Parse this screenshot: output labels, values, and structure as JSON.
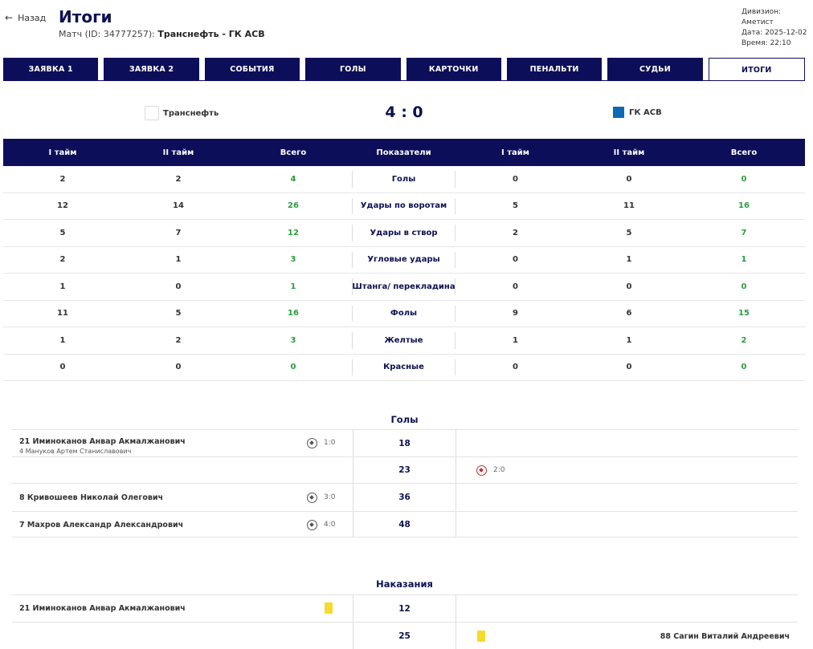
{
  "header": {
    "back_label": "Назад",
    "back_arrow": "←",
    "title": "Итоги",
    "match_prefix": "Матч (ID: 34777257):",
    "match_teams": "Транснефть - ГК АСВ",
    "division": "Дивизион: Аметист",
    "date": "Дата: 2025-12-02",
    "time": "Время: 22:10"
  },
  "tabs": [
    "ЗАЯВКА 1",
    "ЗАЯВКА 2",
    "СОБЫТИЯ",
    "ГОЛЫ",
    "КАРТОЧКИ",
    "ПЕНАЛЬТИ",
    "СУДЬИ",
    "ИТОГИ"
  ],
  "active_tab": 7,
  "teams": {
    "home": {
      "name": "Транснефть",
      "color": "#ffffff"
    },
    "away": {
      "name": "ГК АСВ",
      "color": "#0b6ab7"
    },
    "score": "4 : 0"
  },
  "stats": {
    "headers": [
      "I тайм",
      "II тайм",
      "Всего",
      "Показатели",
      "I тайм",
      "II тайм",
      "Всего"
    ],
    "rows": [
      [
        "2",
        "2",
        "4",
        "Голы",
        "0",
        "0",
        "0"
      ],
      [
        "12",
        "14",
        "26",
        "Удары по воротам",
        "5",
        "11",
        "16"
      ],
      [
        "5",
        "7",
        "12",
        "Удары в створ",
        "2",
        "5",
        "7"
      ],
      [
        "2",
        "1",
        "3",
        "Угловые удары",
        "0",
        "1",
        "1"
      ],
      [
        "1",
        "0",
        "1",
        "Штанга/ перекладина",
        "0",
        "0",
        "0"
      ],
      [
        "11",
        "5",
        "16",
        "Фолы",
        "9",
        "6",
        "15"
      ],
      [
        "1",
        "2",
        "3",
        "Желтые",
        "1",
        "1",
        "2"
      ],
      [
        "0",
        "0",
        "0",
        "Красные",
        "0",
        "0",
        "0"
      ]
    ]
  },
  "goals": {
    "title": "Голы",
    "rows": [
      {
        "minute": "18",
        "side": "home",
        "player": "21 Иминоканов Анвар Акмалжанович",
        "assist": "4 Мануков Артем Станиславович",
        "score": "1:0",
        "own": false
      },
      {
        "minute": "23",
        "side": "away",
        "player": "",
        "assist": "",
        "score": "2:0",
        "own": true
      },
      {
        "minute": "36",
        "side": "home",
        "player": "8 Кривошеев Николай Олегович",
        "assist": "",
        "score": "3:0",
        "own": false
      },
      {
        "minute": "48",
        "side": "home",
        "player": "7 Махров Александр Александрович",
        "assist": "",
        "score": "4:0",
        "own": false
      }
    ]
  },
  "penalties": {
    "title": "Наказания",
    "rows": [
      {
        "minute": "12",
        "side": "home",
        "player": "21 Иминоканов Анвар Акмалжанович",
        "card": "yellow"
      },
      {
        "minute": "25",
        "side": "away",
        "player": "88 Сагин Виталий Андреевич",
        "card": "yellow"
      }
    ]
  }
}
